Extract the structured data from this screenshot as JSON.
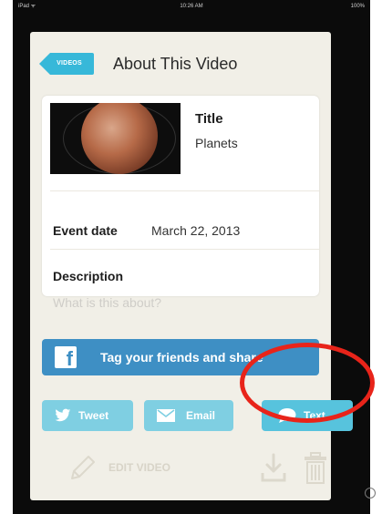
{
  "status_bar": {
    "carrier": "iPad ᯤ",
    "time": "10:26 AM",
    "battery": "100%"
  },
  "header": {
    "back_label": "VIDEOS",
    "title": "About This Video"
  },
  "video": {
    "title_label": "Title",
    "title_value": "Planets",
    "event_label": "Event date",
    "event_value": "March 22, 2013",
    "description_label": "Description",
    "description_placeholder": "What is this about?",
    "description_value": ""
  },
  "share": {
    "facebook_label": "Tag your friends and share",
    "tweet_label": "Tweet",
    "email_label": "Email",
    "text_label": "Text"
  },
  "footer": {
    "edit_label": "EDIT VIDEO"
  },
  "colors": {
    "accent": "#37b8d9",
    "facebook": "#3e8fc4",
    "share_button": "#7fcfe2",
    "annotation": "#e8241a",
    "card_background": "#f1efe7"
  },
  "icons": [
    "facebook-icon",
    "twitter-icon",
    "email-icon",
    "speech-bubble-icon",
    "pencil-icon",
    "download-icon",
    "trash-icon"
  ]
}
